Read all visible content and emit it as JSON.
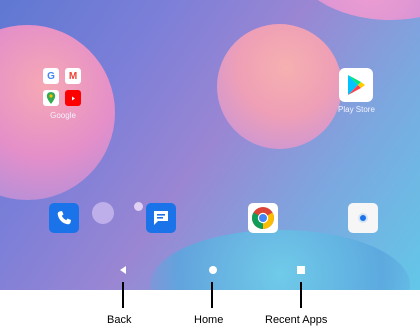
{
  "home_screen": {
    "folder": {
      "label": "Google",
      "apps": [
        "G",
        "M",
        "maps",
        "youtube"
      ]
    },
    "apps": [
      {
        "label": "Play Store",
        "icon": "play-store-icon"
      }
    ],
    "dock": [
      {
        "name": "phone",
        "icon": "phone-icon"
      },
      {
        "name": "messages",
        "icon": "messages-icon"
      },
      {
        "name": "chrome",
        "icon": "chrome-icon"
      },
      {
        "name": "camera",
        "icon": "camera-icon"
      }
    ],
    "folder_letters": {
      "g": "G",
      "m": "M"
    }
  },
  "nav_bar": {
    "back_icon": "back-icon",
    "home_icon": "home-icon",
    "recents_icon": "recent-apps-icon"
  },
  "callouts": {
    "back": "Back",
    "home": "Home",
    "recent_apps": "Recent Apps"
  },
  "colors": {
    "accent_blue": "#1a73e8",
    "callout": "#000000"
  }
}
